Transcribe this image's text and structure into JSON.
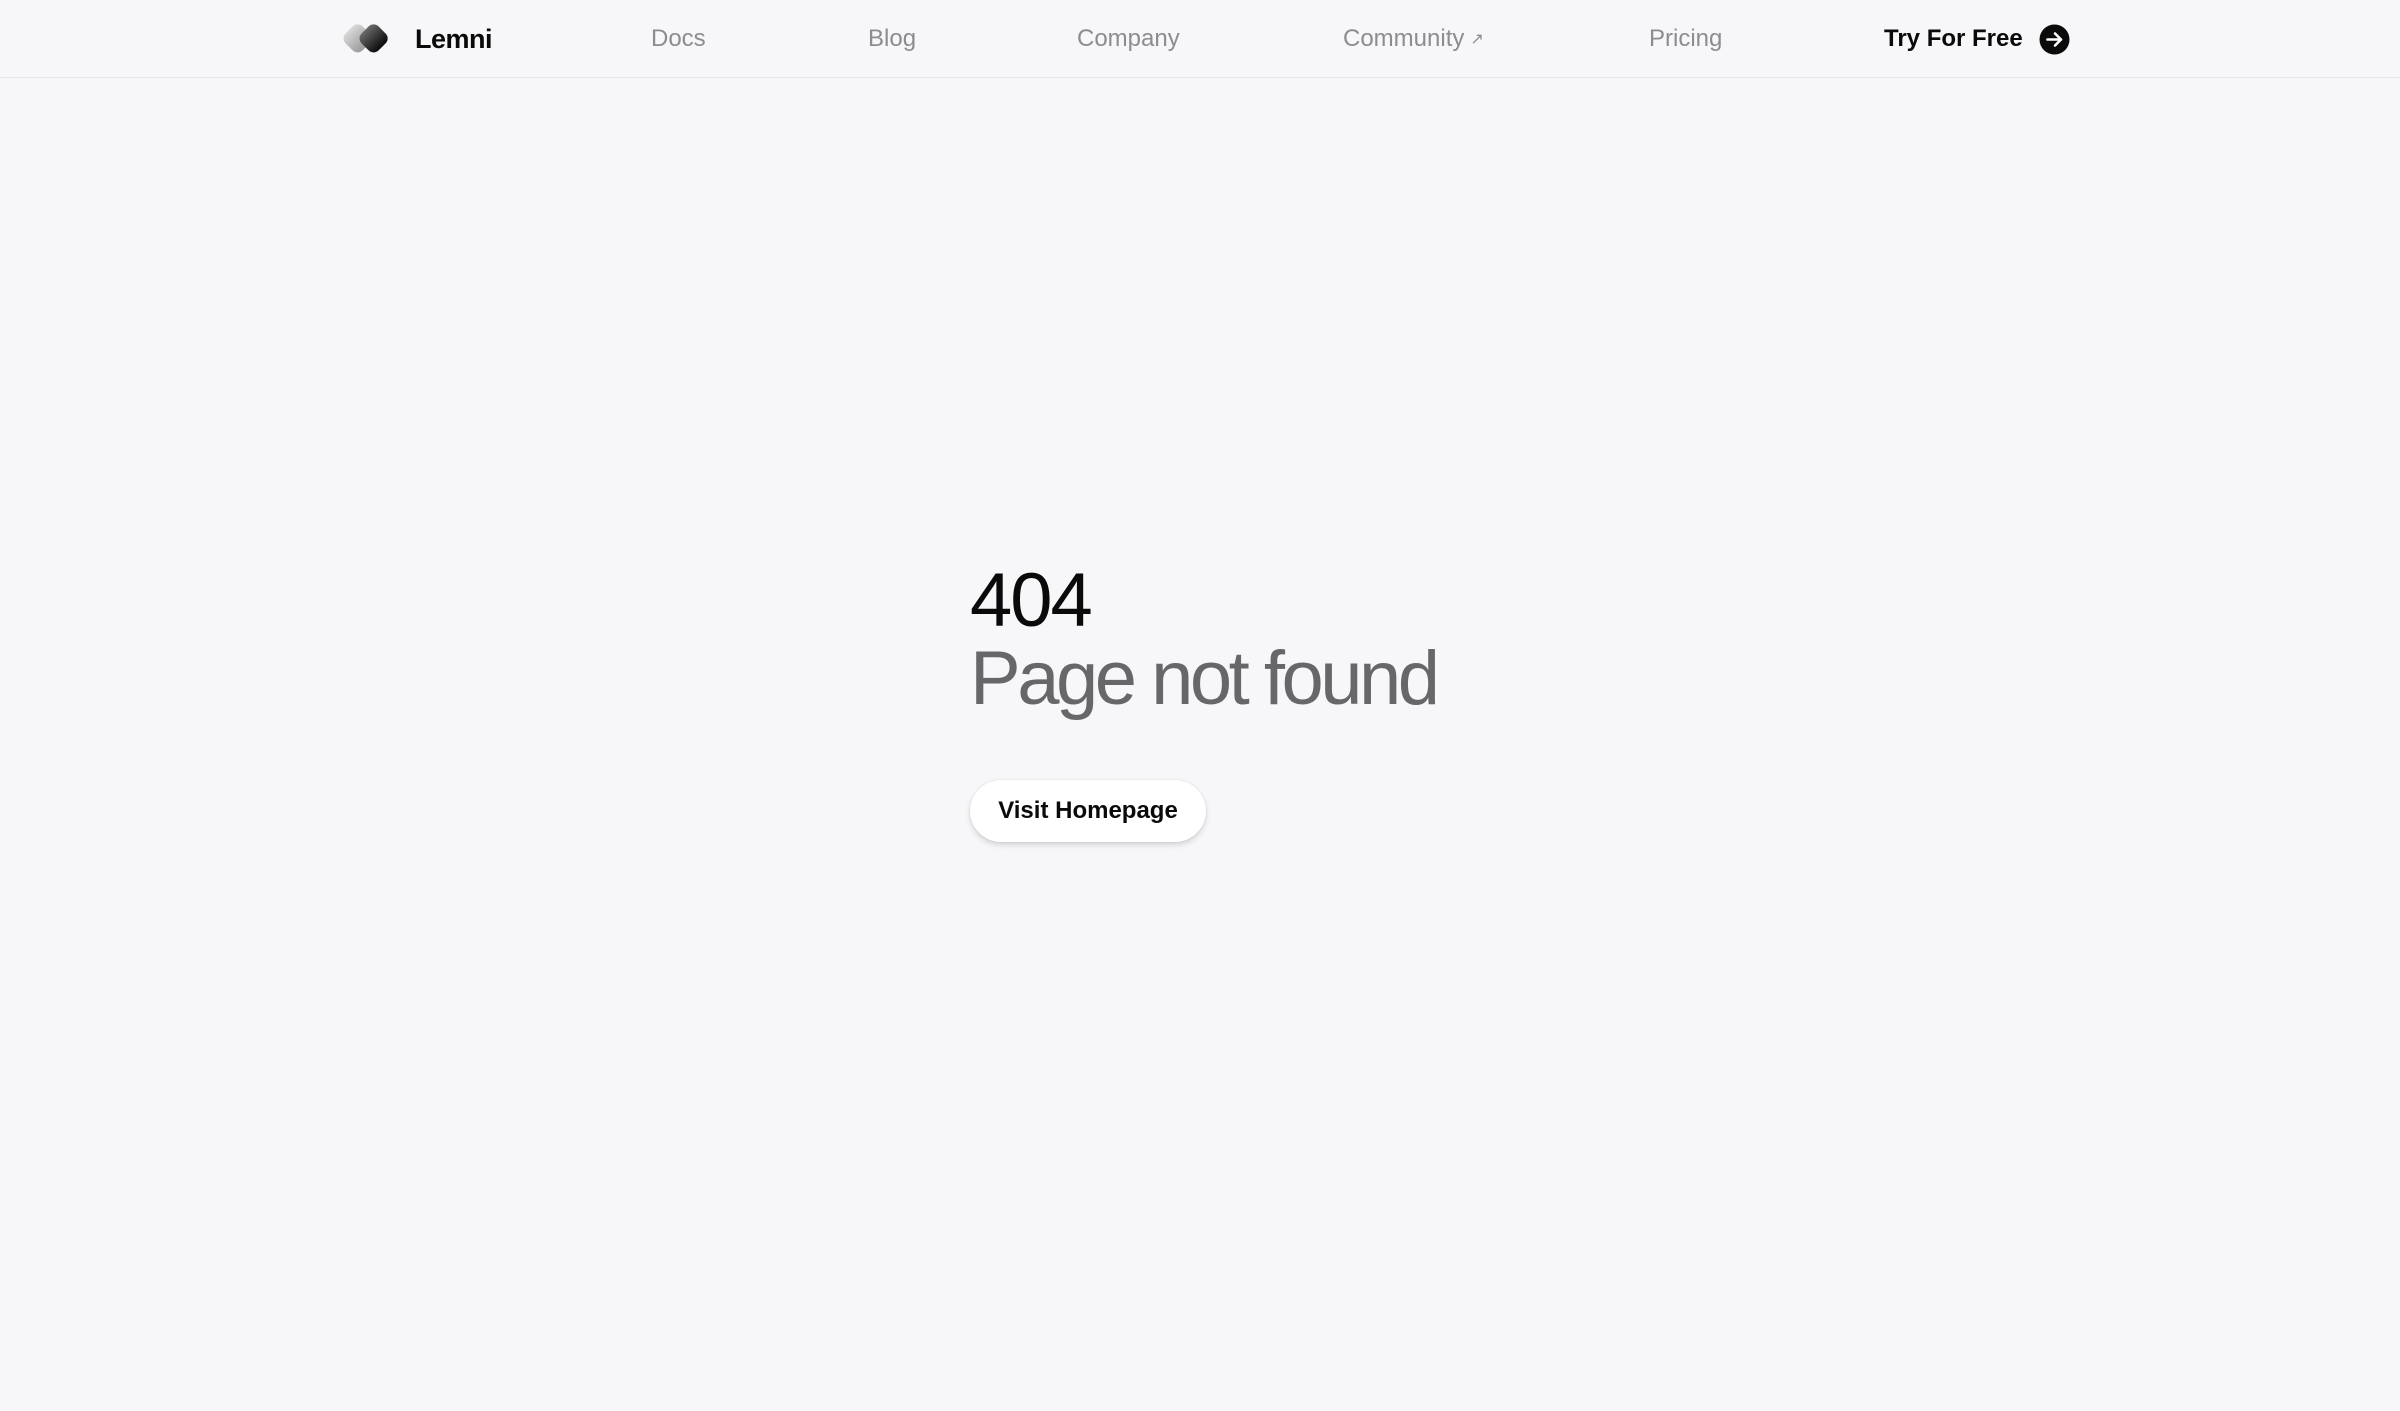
{
  "brand": {
    "name": "Lemni",
    "logo_icon": "lemni-logo-icon"
  },
  "nav": {
    "links": [
      {
        "label": "Docs"
      },
      {
        "label": "Blog"
      },
      {
        "label": "Company"
      },
      {
        "label": "Community",
        "external_icon": "arrow-up-right-icon",
        "external_glyph": "↗"
      },
      {
        "label": "Pricing"
      }
    ],
    "cta": {
      "label": "Try For Free",
      "icon": "arrow-right-circle-icon"
    }
  },
  "error": {
    "code": "404",
    "title": "Page not found"
  },
  "actions": {
    "home_button_label": "Visit Homepage"
  },
  "colors": {
    "background": "#f7f7f9",
    "text_primary": "#0a0a0a",
    "text_muted": "#8c8c91",
    "title_gray": "#66666b",
    "button_bg": "#ffffff"
  }
}
